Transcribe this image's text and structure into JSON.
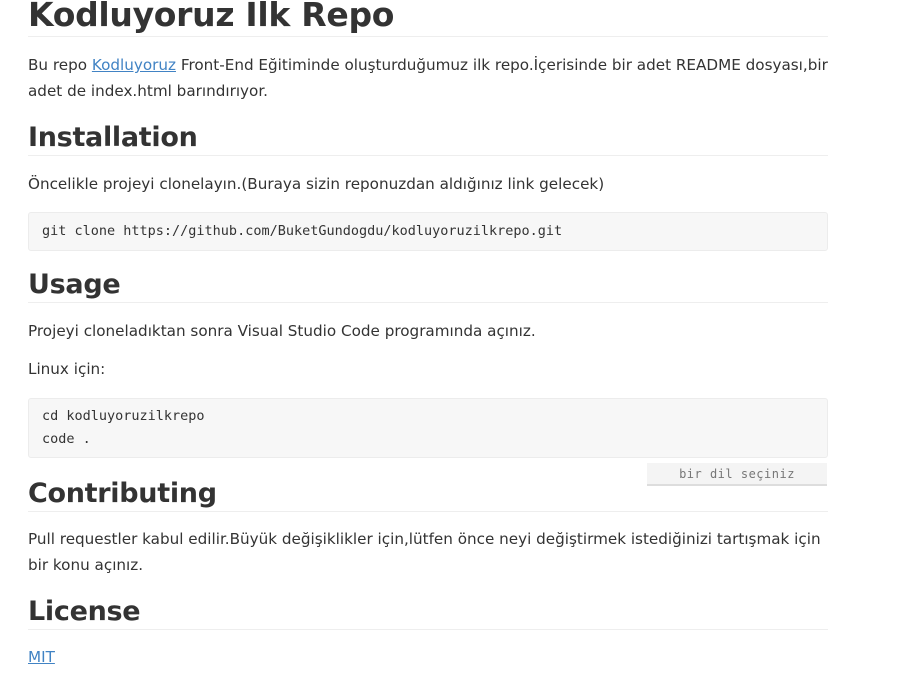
{
  "title": "Kodluyoruz Ilk Repo",
  "intro": {
    "prefix": "Bu repo ",
    "link_text": "Kodluyoruz",
    "suffix": " Front-End Eğitiminde oluşturduğumuz ilk repo.İçerisinde bir adet README dosyası,bir adet de index.html barındırıyor."
  },
  "installation": {
    "heading": "Installation",
    "text": "Öncelikle projeyi clonelayın.(Buraya sizin reponuzdan aldığınız link gelecek)",
    "code": "git clone https://github.com/BuketGundogdu/kodluyoruzilkrepo.git"
  },
  "usage": {
    "heading": "Usage",
    "text": "Projeyi cloneladıktan sonra Visual Studio Code programında açınız.",
    "linux_label": "Linux için:",
    "code_lines": [
      "cd kodluyoruzilkrepo",
      "code ."
    ]
  },
  "language_select": {
    "label": "bir dil seçiniz"
  },
  "contributing": {
    "heading": "Contributing",
    "text": "Pull requestler kabul edilir.Büyük değişiklikler için,lütfen önce neyi değiştirmek istediğinizi tartışmak için bir konu açınız."
  },
  "license": {
    "heading": "License",
    "link_text": "MIT"
  }
}
